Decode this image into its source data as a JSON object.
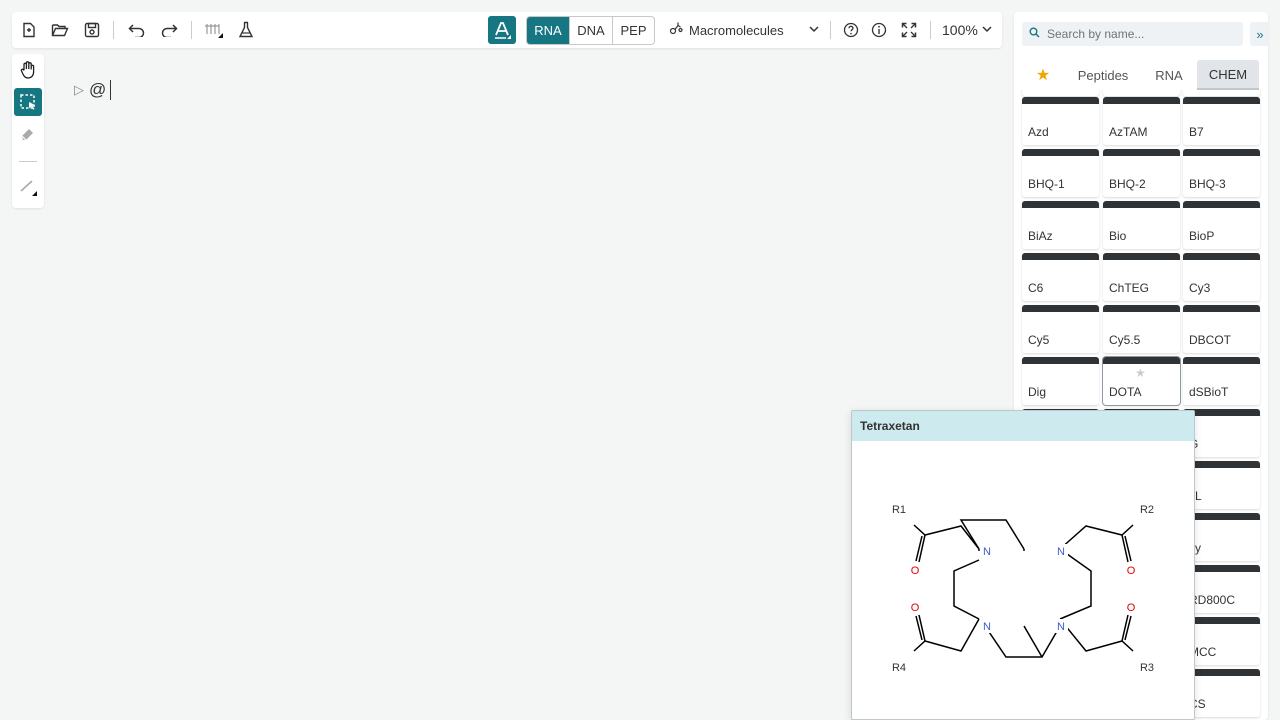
{
  "toolbar": {
    "modes": [
      "RNA",
      "DNA",
      "PEP"
    ],
    "active_mode": "RNA",
    "macromolecules_label": "Macromolecules",
    "zoom_label": "100%"
  },
  "canvas": {
    "sequence_prefix": "@"
  },
  "library": {
    "search_placeholder": "Search by name...",
    "tabs": [
      {
        "label": "★"
      },
      {
        "label": "Peptides"
      },
      {
        "label": "RNA"
      },
      {
        "label": "CHEM"
      }
    ],
    "active_tab": "CHEM",
    "items": [
      {
        "name": "Azd"
      },
      {
        "name": "AzTAM"
      },
      {
        "name": "B7"
      },
      {
        "name": "BHQ-1"
      },
      {
        "name": "BHQ-2"
      },
      {
        "name": "BHQ-3"
      },
      {
        "name": "BiAz"
      },
      {
        "name": "Bio"
      },
      {
        "name": "BioP"
      },
      {
        "name": "C6"
      },
      {
        "name": "ChTEG"
      },
      {
        "name": "Cy3"
      },
      {
        "name": "Cy5"
      },
      {
        "name": "Cy5.5"
      },
      {
        "name": "DBCOT"
      },
      {
        "name": "Dig"
      },
      {
        "name": "DOTA"
      },
      {
        "name": "dSBioT"
      },
      {
        "name": ""
      },
      {
        "name": ""
      },
      {
        "name": "G"
      },
      {
        "name": ""
      },
      {
        "name": ""
      },
      {
        "name": "sL"
      },
      {
        "name": ""
      },
      {
        "name": ""
      },
      {
        "name": "xy"
      },
      {
        "name": ""
      },
      {
        "name": ""
      },
      {
        "name": "RD800C"
      },
      {
        "name": ""
      },
      {
        "name": ""
      },
      {
        "name": "MCC"
      },
      {
        "name": ""
      },
      {
        "name": ""
      },
      {
        "name": "CS"
      }
    ]
  },
  "preview": {
    "title": "Tetraxetan",
    "labels": {
      "r1": "R1",
      "r2": "R2",
      "r3": "R3",
      "r4": "R4",
      "n": "N",
      "o": "O"
    },
    "colors": {
      "nitrogen": "#3a5fcd",
      "oxygen": "#e00000"
    }
  },
  "colors": {
    "accent": "#167782"
  }
}
